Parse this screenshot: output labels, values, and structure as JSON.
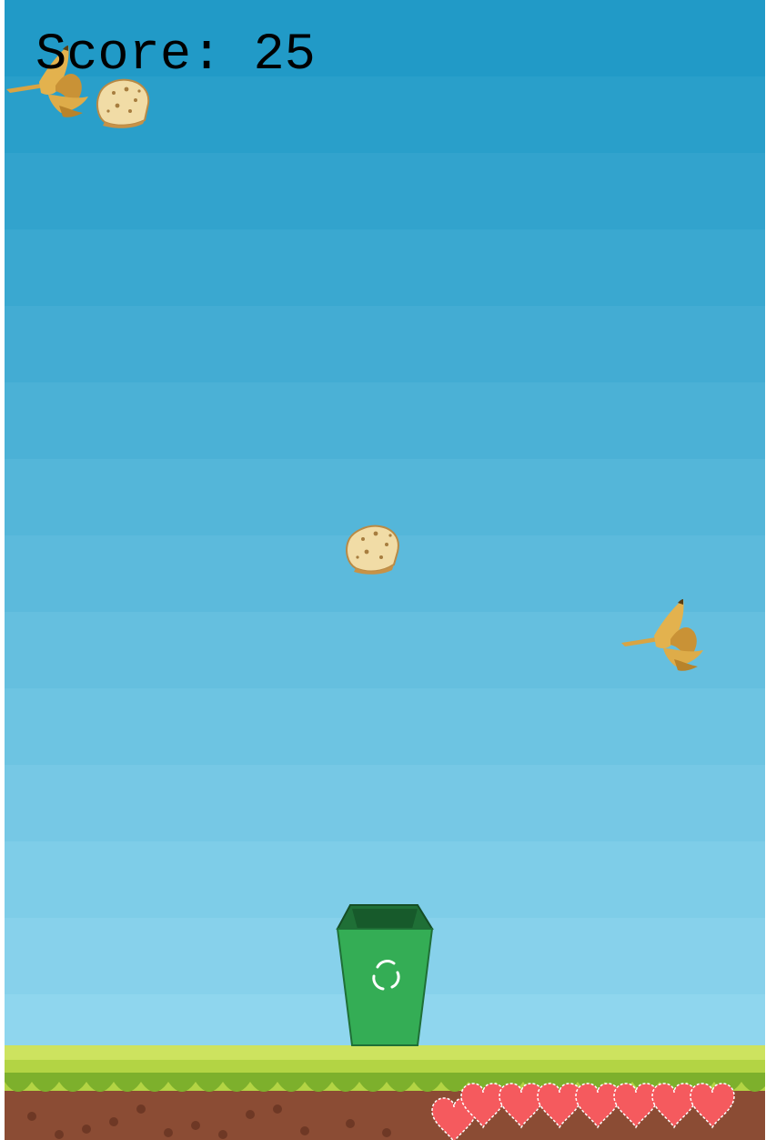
{
  "score_label": "Score:",
  "score_value": "25",
  "colors": {
    "sky_top": "#219ac7",
    "sky_bottom": "#8fd6ee",
    "grass_light": "#c6e05a",
    "grass_dark": "#7db02c",
    "dirt": "#8b4c34",
    "bin_green": "#34ad55",
    "bin_dark": "#1f6f36",
    "heart": "#f55a5e"
  },
  "falling_items": [
    {
      "kind": "banana-peel",
      "icon": "banana-peel-icon"
    },
    {
      "kind": "bread",
      "icon": "bread-icon"
    },
    {
      "kind": "bread",
      "icon": "bread-icon"
    },
    {
      "kind": "banana-peel",
      "icon": "banana-peel-icon"
    }
  ],
  "player": {
    "kind": "recycle-bin",
    "icon": "recycle-icon"
  },
  "lives": 8
}
